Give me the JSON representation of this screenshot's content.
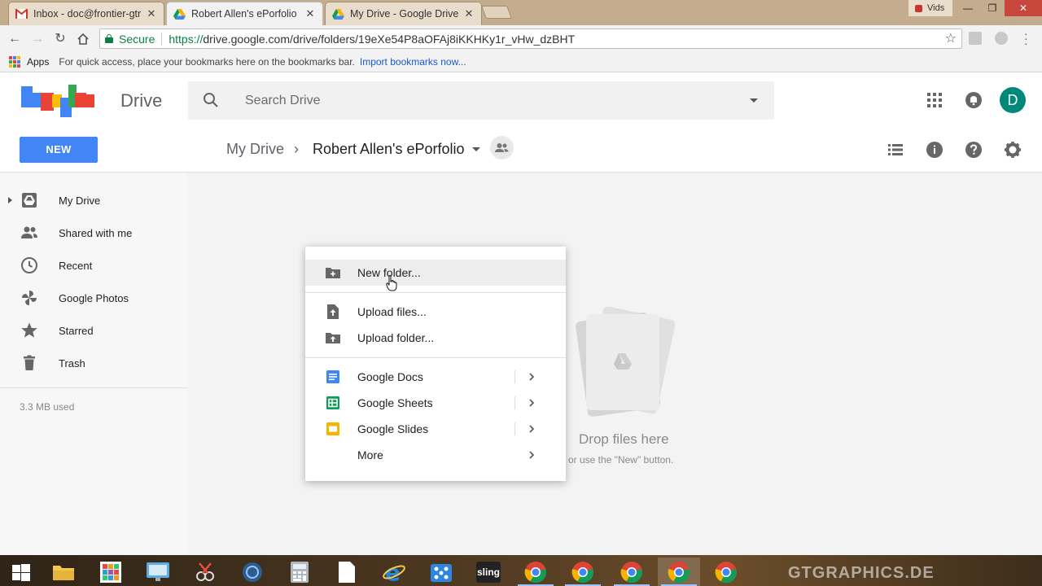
{
  "browser": {
    "tabs": [
      {
        "title": "Inbox - doc@frontier-gtr",
        "favicon": "gmail-icon"
      },
      {
        "title": "Robert Allen's ePorfolio",
        "favicon": "drive-icon",
        "active": true
      },
      {
        "title": "My Drive - Google Drive",
        "favicon": "drive-icon"
      }
    ],
    "close_glyph": "✕",
    "user_label": "Vids",
    "url": {
      "secure_label": "Secure",
      "protocol": "https://",
      "rest": "drive.google.com/drive/folders/19eXe54P8aOFAj8iKKHKy1r_vHw_dzBHT"
    },
    "bookmarks": {
      "apps_label": "Apps",
      "hint": "For quick access, place your bookmarks here on the bookmarks bar.",
      "import_link": "Import bookmarks now..."
    }
  },
  "drive": {
    "brand": "Drive",
    "search_placeholder": "Search Drive",
    "avatar_letter": "D",
    "new_button": "NEW",
    "breadcrumb": {
      "root": "My Drive",
      "separator": "›",
      "current": "Robert Allen's ePorfolio"
    },
    "sidebar": {
      "items": [
        {
          "label": "My Drive",
          "icon": "my-drive-icon"
        },
        {
          "label": "Shared with me",
          "icon": "people-icon"
        },
        {
          "label": "Recent",
          "icon": "clock-icon"
        },
        {
          "label": "Google Photos",
          "icon": "pinwheel-icon"
        },
        {
          "label": "Starred",
          "icon": "star-icon"
        },
        {
          "label": "Trash",
          "icon": "trash-icon"
        }
      ],
      "storage": "3.3 MB used"
    },
    "empty": {
      "title": "Drop files here",
      "subtitle": "or use the \"New\" button."
    },
    "new_menu": {
      "items": [
        {
          "label": "New folder...",
          "icon": "new-folder-icon"
        },
        {
          "label": "Upload files...",
          "icon": "upload-file-icon"
        },
        {
          "label": "Upload folder...",
          "icon": "upload-folder-icon"
        },
        {
          "label": "Google Docs",
          "icon": "docs-icon"
        },
        {
          "label": "Google Sheets",
          "icon": "sheets-icon"
        },
        {
          "label": "Google Slides",
          "icon": "slides-icon"
        },
        {
          "label": "More",
          "icon": ""
        }
      ]
    }
  },
  "taskbar": {
    "sling_label": "sling",
    "watermark": "GTGRAPHICS.DE"
  },
  "colors": {
    "drive_blue": "#4285f4",
    "secure_green": "#0b8043",
    "docs_blue": "#4285f4",
    "sheets_green": "#0f9d58",
    "slides_yellow": "#f4b400",
    "avatar": "#00897b"
  }
}
